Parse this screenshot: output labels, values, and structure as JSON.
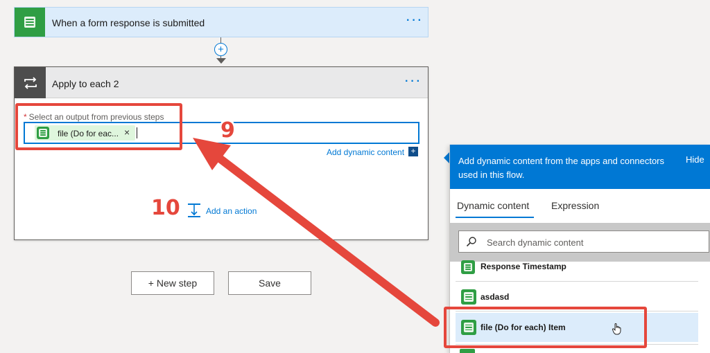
{
  "trigger": {
    "title": "When a form response is submitted",
    "menu": "···"
  },
  "connector": {
    "plus": "+"
  },
  "loop": {
    "title": "Apply to each 2",
    "menu": "···",
    "field": {
      "required_mark": "*",
      "label": "Select an output from previous steps",
      "token_label": "file (Do for eac...",
      "token_remove": "×"
    },
    "add_dynamic_content": "Add dynamic content",
    "add_dynamic_icon": "+",
    "add_action": "Add an action"
  },
  "actions": {
    "new_step": "+ New step",
    "save": "Save"
  },
  "panel": {
    "header_text": "Add dynamic content from the apps and connectors used in this flow.",
    "hide": "Hide",
    "tabs": [
      {
        "label": "Dynamic content",
        "active": true
      },
      {
        "label": "Expression",
        "active": false
      }
    ],
    "search_placeholder": "Search dynamic content",
    "items": [
      {
        "label": "Response Timestamp"
      },
      {
        "label": "asdasd"
      },
      {
        "label": "file (Do for each) Item",
        "highlighted": true
      }
    ]
  },
  "annotations": {
    "step_9": "9",
    "step_10": "10",
    "color": "#e5473c"
  },
  "colors": {
    "accent": "#0078d4",
    "forms_green": "#2f9e44",
    "trigger_bg": "#dcecfb",
    "highlight_bg": "#dcecfb"
  }
}
